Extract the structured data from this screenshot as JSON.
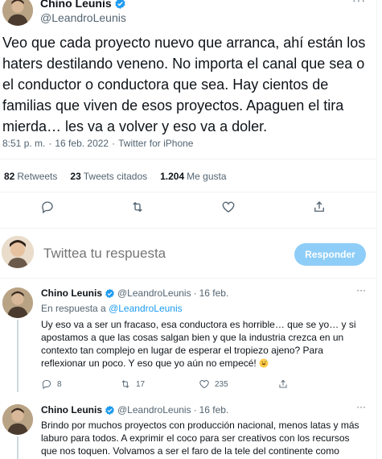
{
  "main_tweet": {
    "author_name": "Chino Leunis",
    "author_handle": "@LeandroLeunis",
    "more_label": "···",
    "text": "Veo que cada proyecto nuevo que arranca, ahí están los haters destilando veneno. No importa el canal que sea o el conductor o conductora que sea. Hay cientos de familias que viven de esos proyectos. Apaguen el tira mierda… les va a volver y eso va a doler.",
    "time": "8:51 p. m.",
    "separator": "·",
    "date": "16 feb. 2022",
    "source": "Twitter for iPhone",
    "stats": {
      "retweets_count": "82",
      "retweets_label": "Retweets",
      "quotes_count": "23",
      "quotes_label": "Tweets citados",
      "likes_count": "1.204",
      "likes_label": "Me gusta"
    },
    "action_icons": [
      "reply-icon",
      "retweet-icon",
      "like-icon",
      "share-icon"
    ]
  },
  "composer": {
    "placeholder": "Twittea tu respuesta",
    "button_label": "Responder"
  },
  "replies": [
    {
      "author_name": "Chino Leunis",
      "author_handle": "@LeandroLeunis",
      "separator": "·",
      "date": "16 feb.",
      "more_label": "···",
      "in_reply_prefix": "En respuesta a",
      "in_reply_handle": "@LeandroLeunis",
      "text": "Uy eso va a ser un fracaso, esa conductora es horrible… que se yo… y si apostamos a que las cosas salgan bien y que la industria crezca en un contexto tan complejo en lugar de esperar el tropiezo ajeno? Para reflexionar un poco. Y eso que yo aún no empecé!",
      "emoji": "grinning-sweat-emoji",
      "reply_count": "8",
      "retweet_count": "17",
      "like_count": "235"
    },
    {
      "author_name": "Chino Leunis",
      "author_handle": "@LeandroLeunis",
      "separator": "·",
      "date": "16 feb.",
      "more_label": "···",
      "text": "Brindo por muchos proyectos con producción nacional, menos latas y más laburo para todos. A exprimir el coco para ser creativos con los recursos que nos toquen. Volvamos a ser el faro de la tele del continente como"
    }
  ],
  "colors": {
    "accent": "#1d9bf0",
    "reply_button_disabled": "#8ecdf8",
    "secondary_text": "#536471",
    "divider": "#eff3f4"
  }
}
